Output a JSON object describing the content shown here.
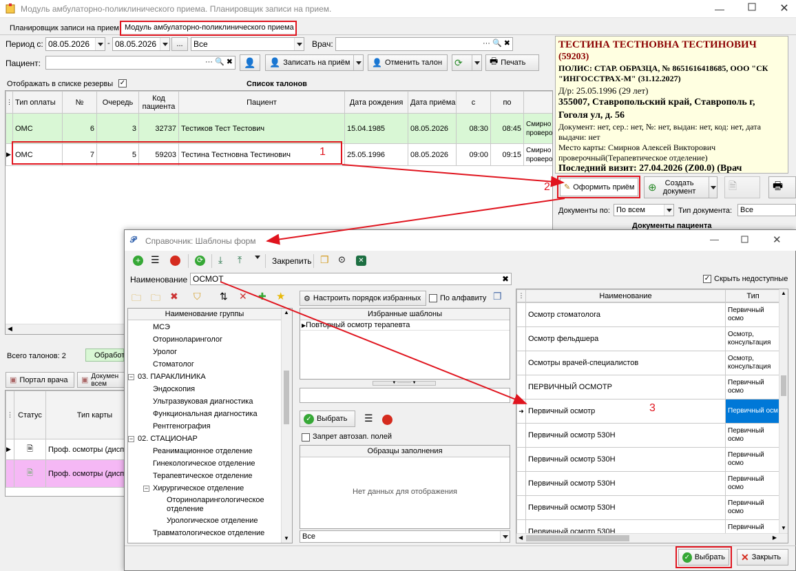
{
  "window": {
    "title": "Модуль амбулаторно-поликлинического приема. Планировщик записи на прием."
  },
  "tabs": [
    {
      "label": "Планировщик записи на прием"
    },
    {
      "label": "Модуль амбулаторно-поликлинического приема"
    }
  ],
  "filters": {
    "period_label": "Период с:",
    "date_from": "08.05.2026",
    "dash": "-",
    "date_to": "08.05.2026",
    "dots": "...",
    "scope": "Все",
    "doctor_label": "Врач:",
    "patient_label": "Пациент:"
  },
  "toolbar": {
    "book_label": "Записать на приём",
    "cancel_label": "Отменить талон",
    "print_label": "Печать"
  },
  "list": {
    "show_reserves": "Отображать в списке резервы",
    "title": "Список талонов",
    "columns": [
      "Тип оплаты",
      "№",
      "Очередь",
      "Код пациента",
      "Пациент",
      "Дата рождения",
      "Дата приёма",
      "с",
      "по"
    ],
    "rows": [
      {
        "pay": "ОМС",
        "num": "6",
        "queue": "3",
        "code": "32737",
        "patient": "Тестиков Тест Тестович",
        "birth": "15.04.1985",
        "visit": "08.05.2026",
        "from": "08:30",
        "to": "08:45",
        "extra": "Смирно проверо"
      },
      {
        "pay": "ОМС",
        "num": "7",
        "queue": "5",
        "code": "59203",
        "patient": "Тестина Тестновна Тестинович",
        "birth": "25.05.1996",
        "visit": "08.05.2026",
        "from": "09:00",
        "to": "09:15",
        "extra": "Смирно проверо"
      }
    ],
    "total": "Всего талонов: 2",
    "processed": "Обработ"
  },
  "bottom_tabs": {
    "portal": "Портал врача",
    "docs": "Докумен всем"
  },
  "cards": {
    "columns": [
      "Статус",
      "Тип карты"
    ],
    "rows": [
      "Проф. осмотры (диспа",
      "Проф. осмотры (диспа"
    ]
  },
  "patient_card": {
    "name": "ТЕСТИНА ТЕСТНОВНА ТЕСТИНОВИЧ",
    "code": "(59203)",
    "policy": "ПОЛИС: СТАР. ОБРАЗЦА, № 8651616418685, ООО \"СК \"ИНГОССТРАХ-М\" (31.12.2027)",
    "dob": "Д/р: 25.05.1996 (29 лет)",
    "address": "355007, Ставропольский край, Ставрополь г, Гоголя ул, д. 56",
    "document": "Документ: нет, сер.: нет, №: нет, выдан: нет, код: нет, дата выдачи: нет",
    "card_place": "Место карты: Смирнов Алексей Викторович проверочный(Терапевтическое отделение)",
    "last_visit": "Последний визит: 27.04.2026 (Z00.0) (Врач"
  },
  "actions": {
    "register_label": "Оформить приём",
    "create_doc_label": "Создать документ",
    "docs_by_label": "Документы по:",
    "docs_by_value": "По всем",
    "doc_type_label": "Тип документа:",
    "doc_type_value": "Все",
    "patient_docs_title": "Документы пациента"
  },
  "dialog": {
    "title": "Справочник: Шаблоны форм",
    "pin_label": "Закрепить",
    "name_label": "Наименование",
    "name_value": "ОСМОТ",
    "hide_unavailable": "Скрыть недоступные",
    "group_header": "Наименование группы",
    "tree": [
      {
        "text": "МСЭ",
        "level": 2
      },
      {
        "text": "Оториноларинголог",
        "level": 2
      },
      {
        "text": "Уролог",
        "level": 2
      },
      {
        "text": "Стоматолог",
        "level": 2
      },
      {
        "text": "03. ПАРАКЛИНИКА",
        "level": 1,
        "toggle": "−"
      },
      {
        "text": "Эндоскопия",
        "level": 2
      },
      {
        "text": "Ультразвуковая диагностика",
        "level": 2
      },
      {
        "text": "Функциональная диагностика",
        "level": 2
      },
      {
        "text": "Рентгенография",
        "level": 2
      },
      {
        "text": "02. СТАЦИОНАР",
        "level": 1,
        "toggle": "−"
      },
      {
        "text": "Реанимационное отделение",
        "level": 2
      },
      {
        "text": "Гинекологическое отделение",
        "level": 2
      },
      {
        "text": "Терапевтическое отделение",
        "level": 2
      },
      {
        "text": "Хирургическое отделение",
        "level": 2,
        "toggle": "−"
      },
      {
        "text": "Оториноларингологическое отделение",
        "level": 3
      },
      {
        "text": "Урологическое отделение",
        "level": 3
      },
      {
        "text": "Травматологическое отделение",
        "level": 2
      }
    ],
    "fav_order_label": "Настроить порядок избранных",
    "alphabet_label": "По алфавиту",
    "fav_header": "Избранные шаблоны",
    "fav_items": [
      "Повторный осмотр терапевта"
    ],
    "select_label": "Выбрать",
    "autofill_ban": "Запрет автозап. полей",
    "samples_header": "Образцы заполнения",
    "no_data": "Нет данных для отображения",
    "samples_filter": "Все",
    "results_columns": [
      "Наименование",
      "Тип"
    ],
    "results": [
      {
        "name": "Осмотр стоматолога",
        "type": "Первичный осмо"
      },
      {
        "name": "Осмотр фельдшера",
        "type": "Осмотр, консультация"
      },
      {
        "name": "Осмотры врачей-специалистов",
        "type": "Осмотр, консультация"
      },
      {
        "name": "ПЕРВИЧНЫЙ ОСМОТР",
        "type": "Первичный осмо"
      },
      {
        "name": "Первичный осмотр",
        "type": "Первичный осм"
      },
      {
        "name": "Первичный осмотр 530Н",
        "type": "Первичный осмо"
      },
      {
        "name": "Первичный осмотр 530Н",
        "type": "Первичный осмо"
      },
      {
        "name": "Первичный осмотр 530Н",
        "type": "Первичный осмо"
      },
      {
        "name": "Первичный осмотр 530Н",
        "type": "Первичный осмо"
      },
      {
        "name": "Первичный осмотр 530Н",
        "type": "Первичный осмо"
      }
    ],
    "ok_label": "Выбрать",
    "close_label": "Закрыть"
  },
  "annotations": {
    "n1": "1",
    "n2": "2",
    "n3": "3"
  },
  "colors": {
    "green_row": "#d9f7d5",
    "yellow_card": "#ffffe1",
    "pink_row": "#f5b8f5",
    "select_blue": "#0078d7",
    "annot_red": "#e0141e"
  }
}
